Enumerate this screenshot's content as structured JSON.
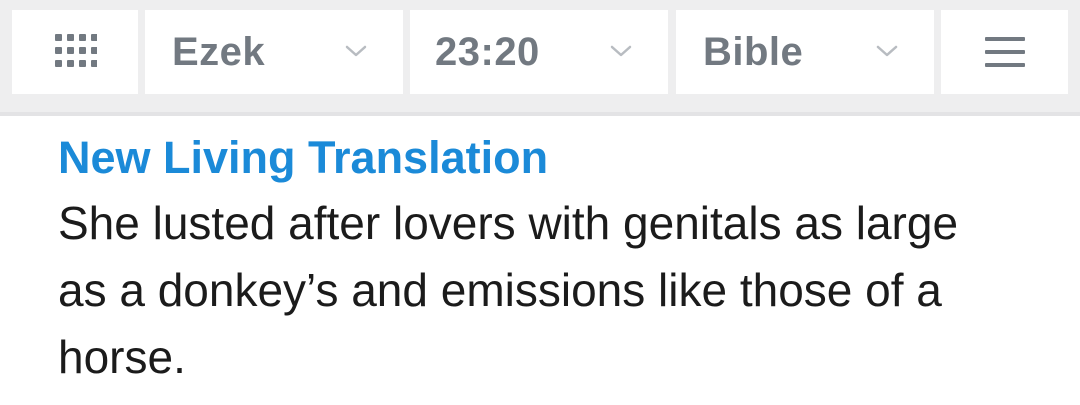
{
  "toolbar": {
    "apps": {
      "icon": "grid-icon"
    },
    "book": {
      "label": "Ezek",
      "icon": "chevron-down-icon"
    },
    "chapter": {
      "label": "23:20",
      "icon": "chevron-down-icon"
    },
    "version": {
      "label": "Bible",
      "icon": "chevron-down-icon"
    },
    "menu": {
      "icon": "hamburger-menu-icon"
    },
    "colors": {
      "background": "#eeeeef",
      "button": "#ffffff",
      "label": "#727981"
    }
  },
  "content": {
    "translation_title": "New Living Translation",
    "verse_text": "She lusted after lovers with genitals as large as a donkey’s and emissions like those of a horse.",
    "colors": {
      "title": "#1b8ad8",
      "text": "#1b1b1b"
    }
  }
}
